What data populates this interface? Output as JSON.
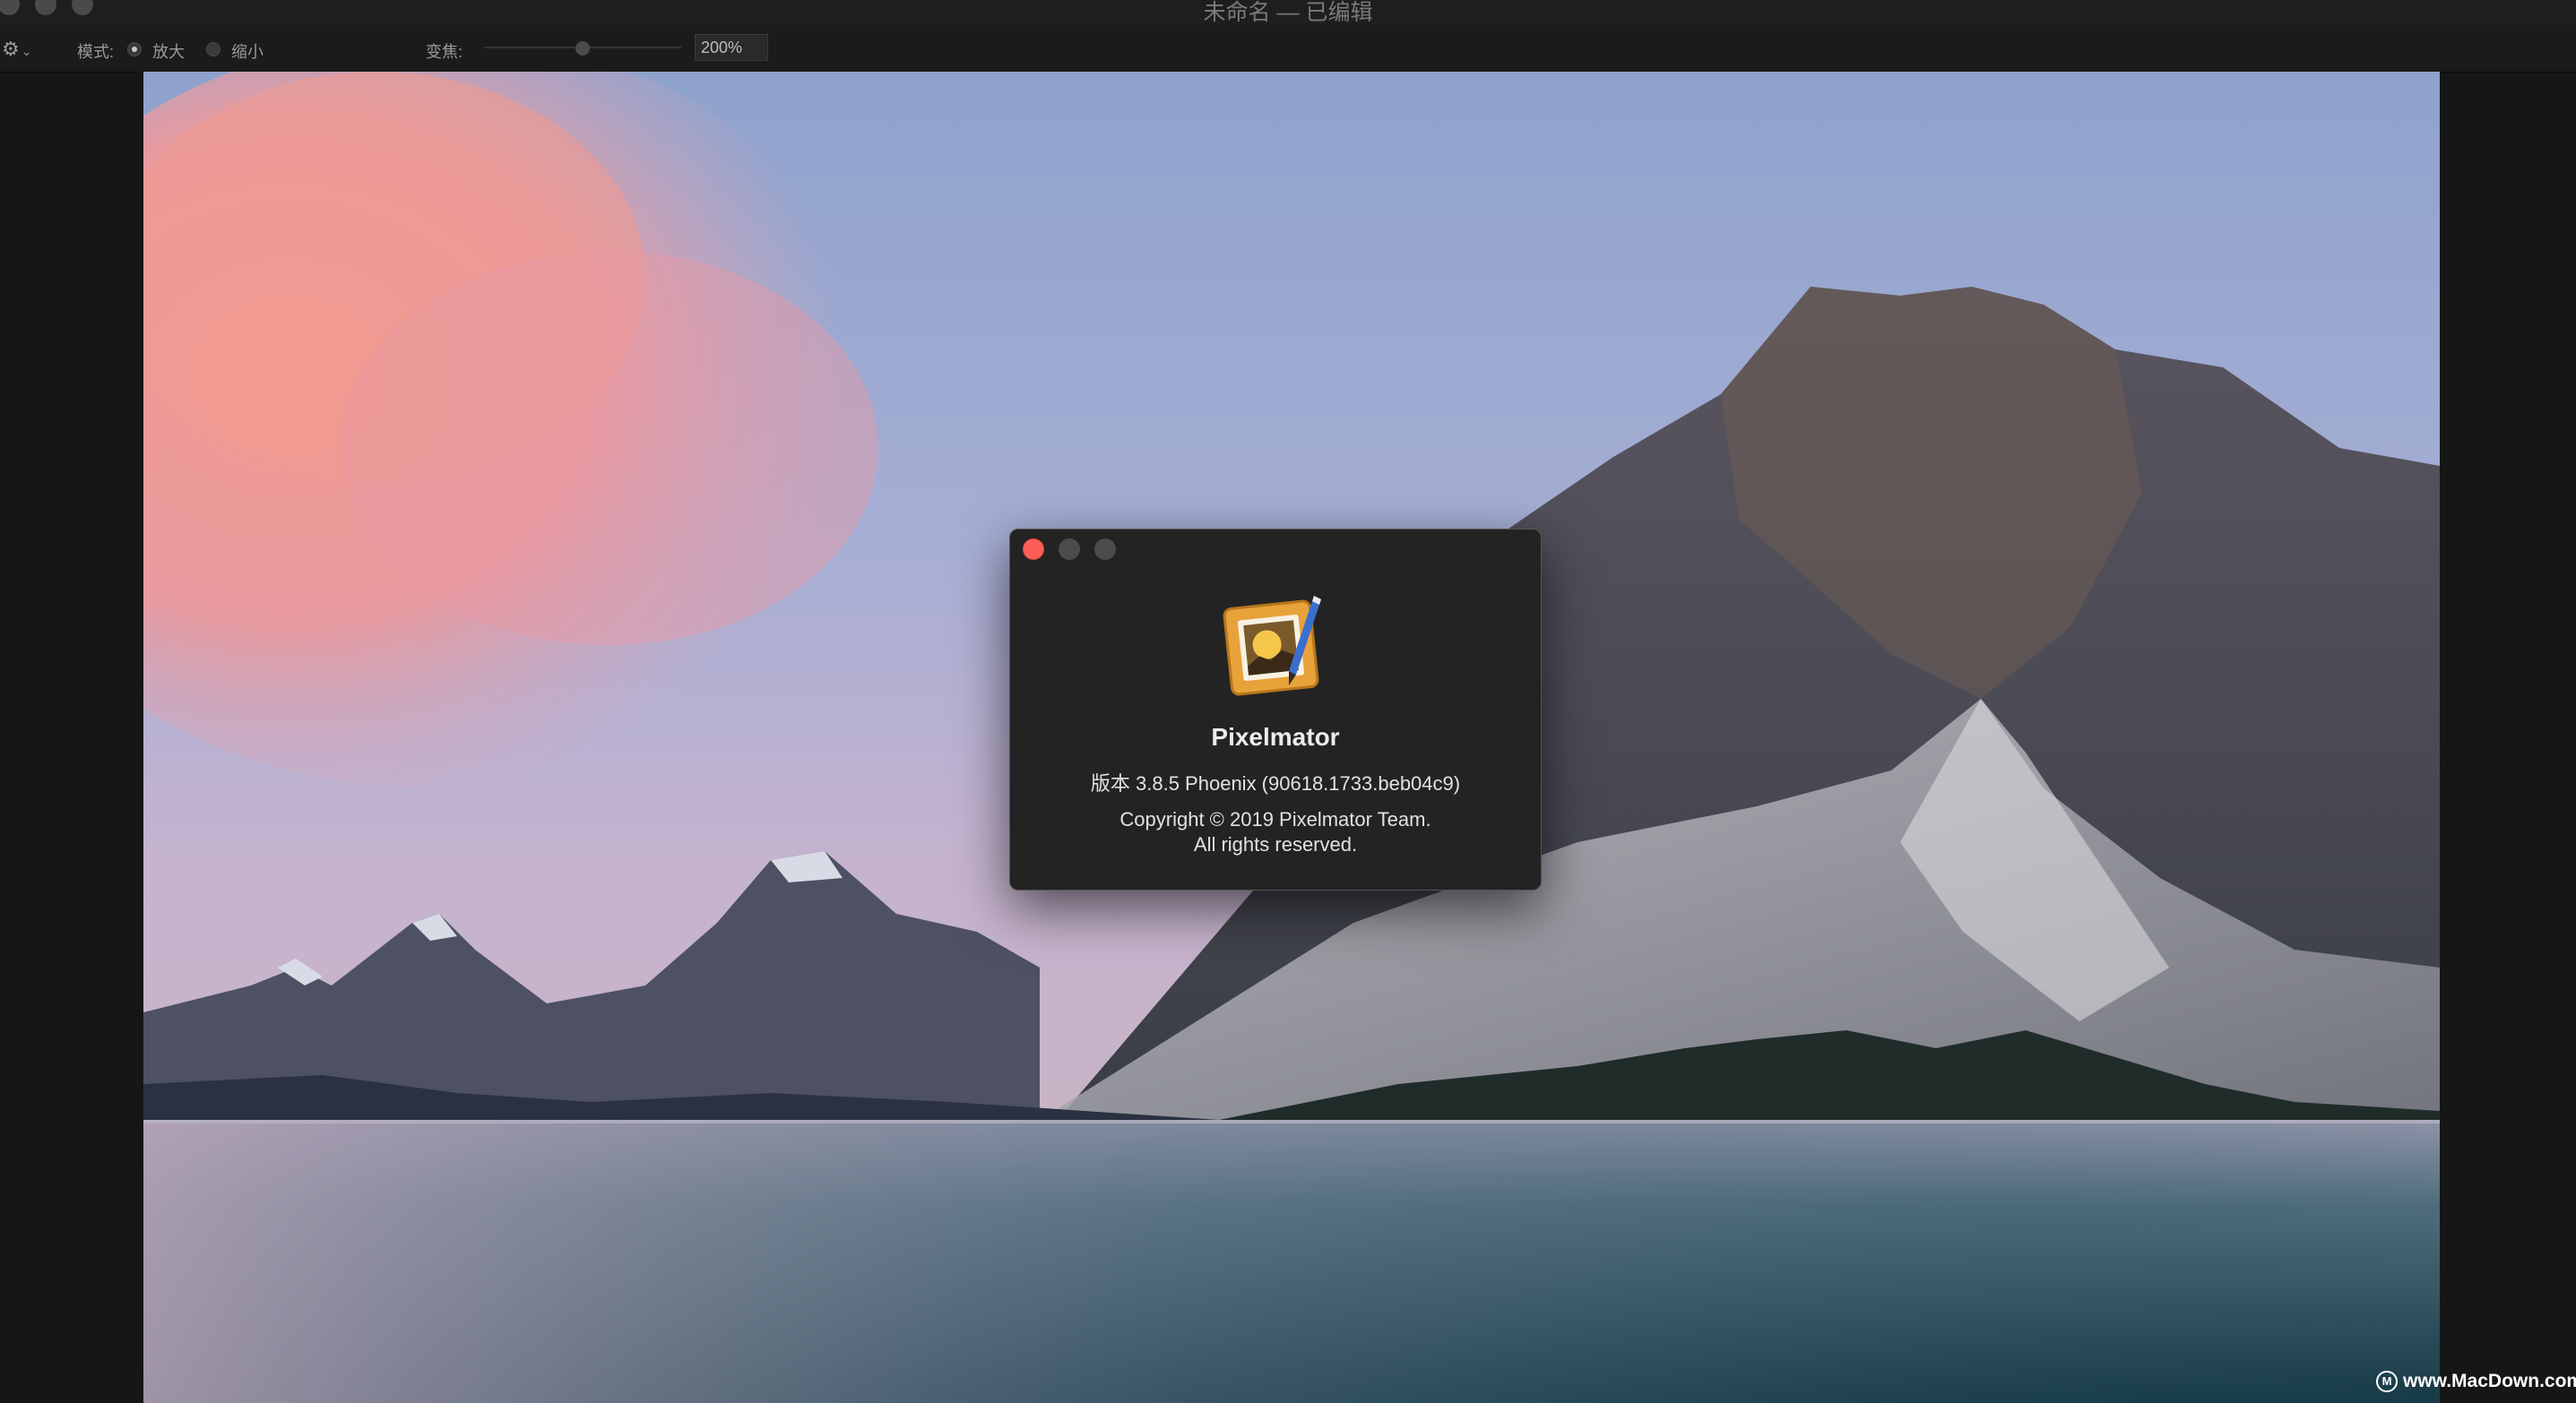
{
  "window": {
    "title": "未命名 — 已编辑"
  },
  "toolbar": {
    "mode_label": "模式:",
    "mode_options": [
      "放大",
      "缩小"
    ],
    "mode_selected": "放大",
    "zoom_label": "变焦:",
    "zoom_value": "200%"
  },
  "about": {
    "app_name": "Pixelmator",
    "version": "版本 3.8.5 Phoenix (90618.1733.beb04c9)",
    "copyright_line1": "Copyright © 2019 Pixelmator Team.",
    "copyright_line2": "All rights reserved.",
    "icon": "pixelmator-app-icon",
    "close_color": "#fd5f57"
  },
  "watermark": {
    "text": "www.MacDown.com",
    "icon": "macdown-logo-icon"
  },
  "icons": {
    "gear": "gear-icon",
    "chevron": "chevron-down-icon"
  }
}
